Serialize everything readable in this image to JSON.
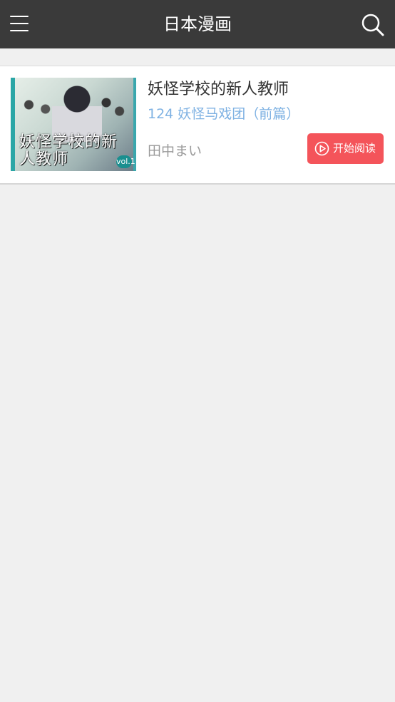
{
  "header": {
    "title": "日本漫画",
    "menu_icon": "menu-icon",
    "search_icon": "search-icon",
    "background": "#3a3a3a"
  },
  "manga": {
    "title": "妖怪学校的新人教师",
    "latest_chapter": "124 妖怪马戏团（前篇）",
    "author": "田中まい",
    "cover": {
      "title_text": "妖怪学校的新人教师",
      "volume_badge": "vol.1"
    },
    "read_button": {
      "label": "开始阅读",
      "icon": "play-circle-icon",
      "color": "#f4545a"
    }
  },
  "colors": {
    "chapter_text": "#7fb2e3",
    "page_background": "#f0f0f0"
  }
}
